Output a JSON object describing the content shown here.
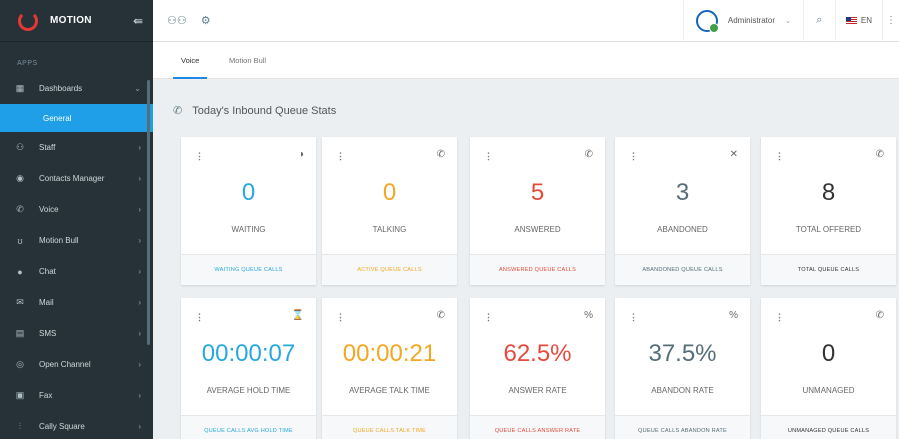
{
  "app": {
    "name": "MOTION"
  },
  "sidebar": {
    "section_label": "APPS",
    "items": [
      {
        "label": "Dashboards",
        "icon": "dashboard-icon",
        "glyph": "▦"
      },
      {
        "label": "General"
      },
      {
        "label": "Staff",
        "icon": "staff-icon",
        "glyph": "👥"
      },
      {
        "label": "Contacts Manager",
        "icon": "contacts-icon",
        "glyph": "◉"
      },
      {
        "label": "Voice",
        "icon": "phone-icon",
        "glyph": "✆"
      },
      {
        "label": "Motion Bull",
        "icon": "bull-icon",
        "glyph": "ʊ"
      },
      {
        "label": "Chat",
        "icon": "chat-icon",
        "glyph": "●"
      },
      {
        "label": "Mail",
        "icon": "mail-icon",
        "glyph": "✉"
      },
      {
        "label": "SMS",
        "icon": "sms-icon",
        "glyph": "▤"
      },
      {
        "label": "Open Channel",
        "icon": "open-channel-icon",
        "glyph": "◎"
      },
      {
        "label": "Fax",
        "icon": "fax-icon",
        "glyph": "▣"
      },
      {
        "label": "Cally Square",
        "icon": "cally-square-icon",
        "glyph": "⫶"
      }
    ]
  },
  "topbar": {
    "username": "Administrator",
    "language": "EN"
  },
  "tabs": [
    {
      "label": "Voice"
    },
    {
      "label": "Motion Bull"
    }
  ],
  "heading": "Today's Inbound Queue Stats",
  "cards": [
    {
      "value": "0",
      "label": "WAITING",
      "footer": "WAITING QUEUE CALLS",
      "color": "#29a8e0",
      "icon": "pie-chart-icon",
      "glyph": "◑"
    },
    {
      "value": "0",
      "label": "TALKING",
      "footer": "ACTIVE QUEUE CALLS",
      "color": "#f5a623",
      "icon": "phone-in-talk-icon",
      "glyph": "✆"
    },
    {
      "value": "5",
      "label": "ANSWERED",
      "footer": "ANSWERED QUEUE CALLS",
      "color": "#e64a3b",
      "icon": "phone-icon",
      "glyph": "✆"
    },
    {
      "value": "3",
      "label": "ABANDONED",
      "footer": "ABANDONED QUEUE CALLS",
      "color": "#546e7a",
      "icon": "phone-missed-icon",
      "glyph": "✕"
    },
    {
      "value": "8",
      "label": "TOTAL OFFERED",
      "footer": "TOTAL QUEUE CALLS",
      "color": "#333333",
      "icon": "phone-callback-icon",
      "glyph": "✆"
    },
    {
      "value": "00:00:07",
      "label": "AVERAGE HOLD TIME",
      "footer": "QUEUE CALLS AVG HOLD TIME",
      "color": "#29a8e0",
      "icon": "hourglass-icon",
      "glyph": "⌛"
    },
    {
      "value": "00:00:21",
      "label": "AVERAGE TALK TIME",
      "footer": "QUEUE CALLS TALK TIME",
      "color": "#f5a623",
      "icon": "phone-in-talk-icon",
      "glyph": "✆"
    },
    {
      "value": "62.5%",
      "label": "ANSWER RATE",
      "footer": "QUEUE CALLS ANSWER RATE",
      "color": "#e64a3b",
      "icon": "percent-icon",
      "glyph": "%"
    },
    {
      "value": "37.5%",
      "label": "ABANDON RATE",
      "footer": "QUEUE CALLS ABANDON RATE",
      "color": "#546e7a",
      "icon": "percent-icon",
      "glyph": "%"
    },
    {
      "value": "0",
      "label": "UNMANAGED",
      "footer": "UNMANAGED QUEUE CALLS",
      "color": "#333333",
      "icon": "phone-forward-icon",
      "glyph": "✆"
    }
  ]
}
